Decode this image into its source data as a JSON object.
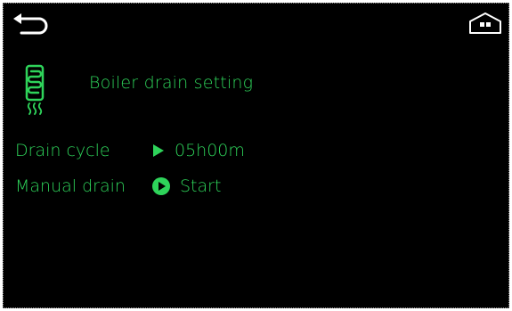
{
  "header": {
    "back_icon": "back-arrow-icon",
    "home_icon": "home-icon"
  },
  "title": {
    "icon": "boiler-heater-icon",
    "text": "Boiler drain setting"
  },
  "settings": {
    "drain_cycle": {
      "label": "Drain cycle",
      "icon": "play-triangle-icon",
      "value": "05h00m"
    },
    "manual_drain": {
      "label": "Manual drain",
      "icon": "play-circle-icon",
      "value": "Start"
    }
  },
  "colors": {
    "background": "#000000",
    "accent": "#2ed35a",
    "icon_white": "#ffffff"
  }
}
